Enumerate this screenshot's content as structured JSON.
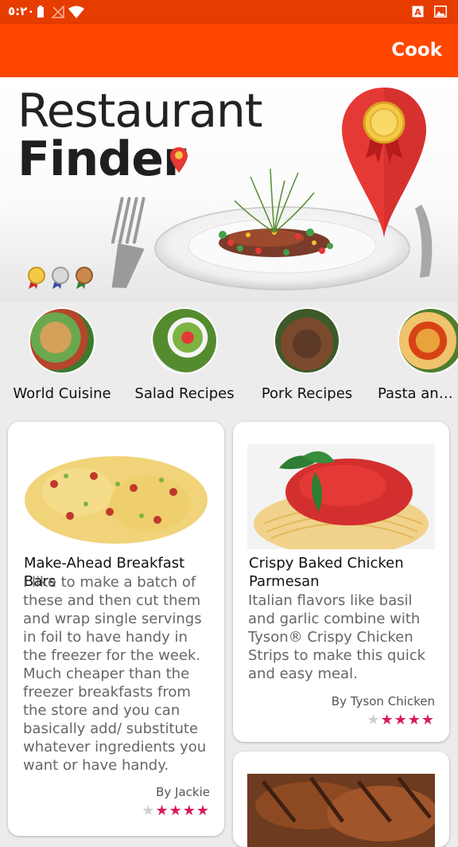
{
  "status_bar": {
    "time": "٥:٢٠"
  },
  "app_bar": {
    "action_label": "Cook"
  },
  "banner": {
    "title_line1": "Restaurant",
    "title_line2": "Finder"
  },
  "categories": [
    {
      "label": "World Cuisine"
    },
    {
      "label": "Salad Recipes"
    },
    {
      "label": "Pork Recipes"
    },
    {
      "label": "Pasta and Noodles"
    }
  ],
  "recipes": [
    {
      "title": "Make-Ahead Breakfast Bars",
      "description": "I like to make a batch of these and then cut them and wrap single servings in foil to have handy in the freezer for the week. Much cheaper than the freezer breakfasts from the store and you can basically add/ substitute whatever ingredients you want or have handy.",
      "author": "By Jackie",
      "rating": 4
    },
    {
      "title": "Crispy Baked Chicken Parmesan",
      "description": "Italian flavors like basil and garlic combine with Tyson® Crispy Chicken Strips to make this quick and easy meal.",
      "author": "By Tyson Chicken",
      "rating": 4
    }
  ]
}
